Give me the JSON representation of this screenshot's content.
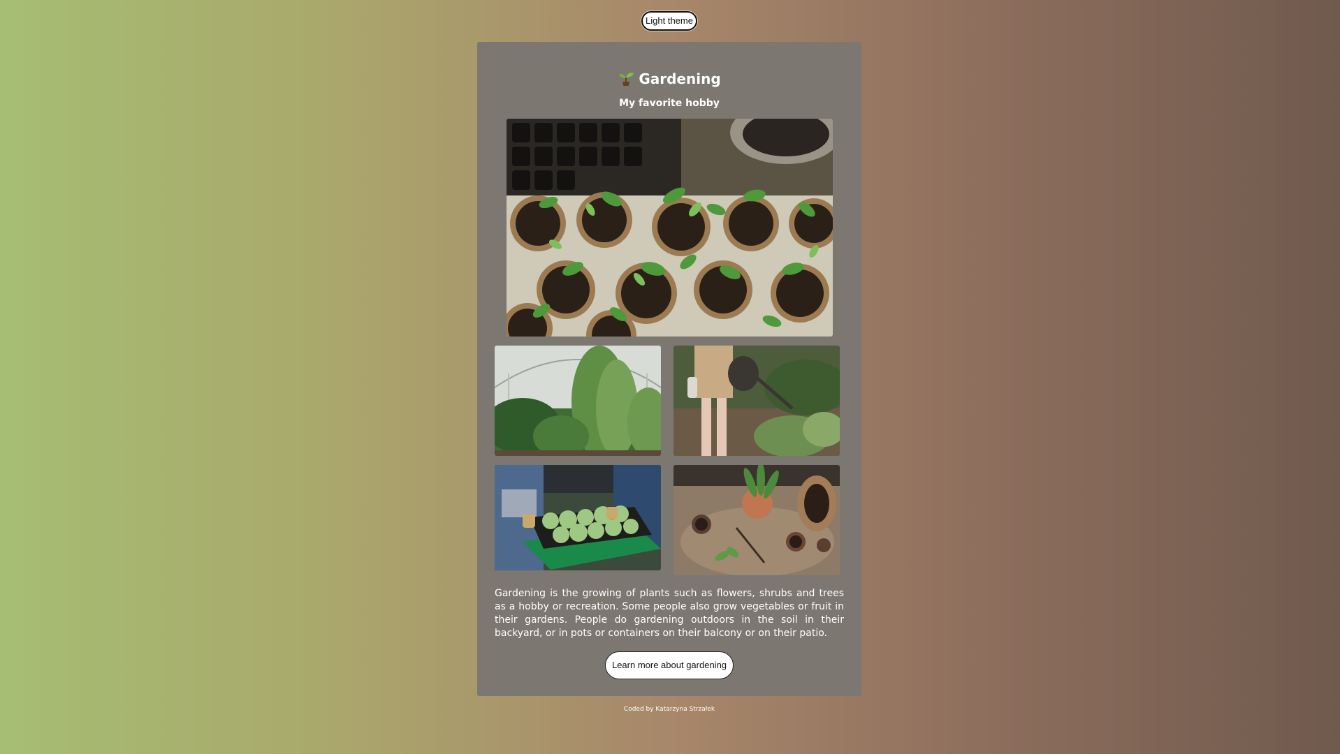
{
  "theme_toggle": {
    "label": "Light theme"
  },
  "header": {
    "icon": "seedling-icon",
    "title": "Gardening",
    "subtitle": "My favorite hobby"
  },
  "gallery": {
    "hero": {
      "subject": "seedlings-in-peat-pots"
    },
    "images": [
      {
        "subject": "greenhouse-plants"
      },
      {
        "subject": "watering-can-garden"
      },
      {
        "subject": "tray-of-seedlings"
      },
      {
        "subject": "potting-plants"
      }
    ]
  },
  "description": "Gardening is the growing of plants such as flowers, shrubs and trees as a hobby or recreation. Some people also grow vegetables or fruit in their gardens. People do gardening outdoors in the soil in their backyard, or in pots or containers on their balcony or on their patio.",
  "cta": {
    "label": "Learn more about gardening"
  },
  "footer": {
    "text": "Coded by Katarzyna Strzałek"
  },
  "colors": {
    "card_background": "#7c7770",
    "gradient_start": "#a5be72",
    "gradient_end": "#705a4d",
    "button_background": "#ffffff"
  }
}
